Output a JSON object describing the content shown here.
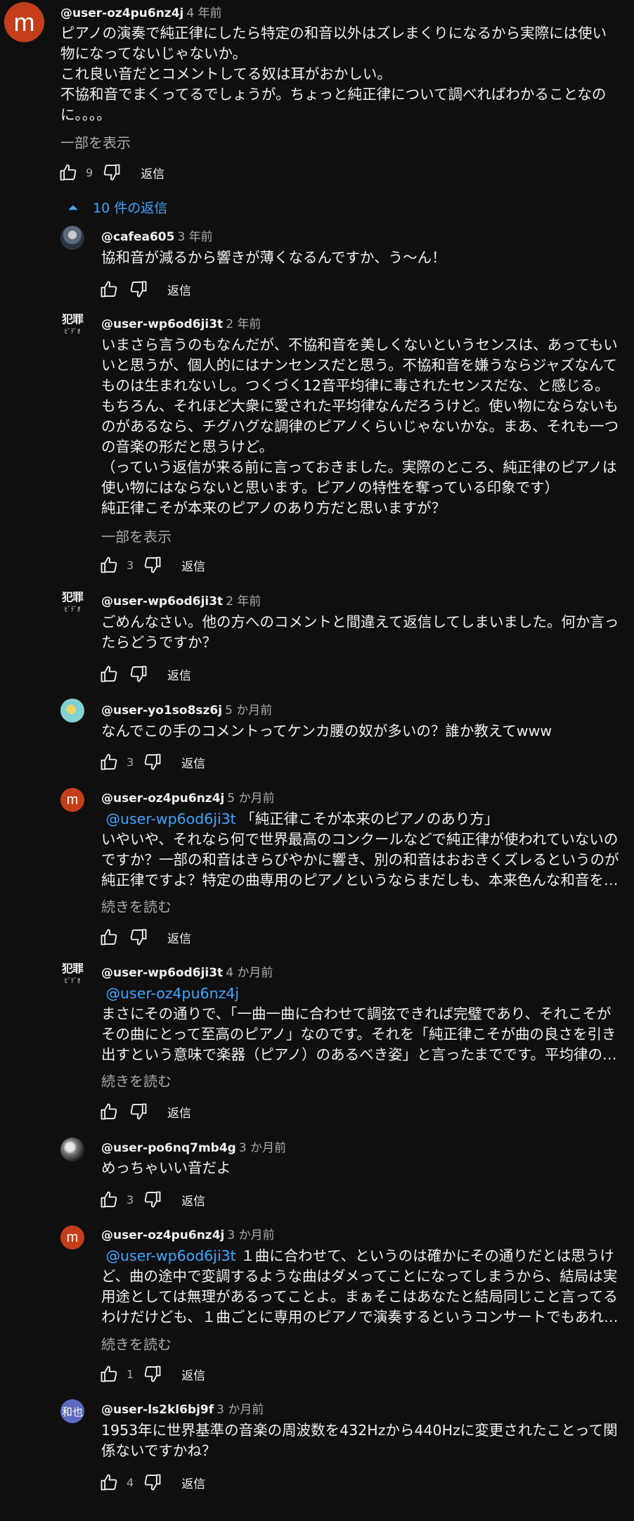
{
  "ui": {
    "show_more": "一部を表示",
    "read_more": "続きを読む",
    "reply": "返信"
  },
  "top_comment": {
    "avatar": "m",
    "author": "@user-oz4pu6nz4j",
    "time": "4 年前",
    "body_lines": [
      "ピアノの演奏で純正律にしたら特定の和音以外はズレまくりになるから実際には使い",
      "物になってないじゃないか。",
      "これ良い音だとコメントしてる奴は耳がおかしい。",
      "不協和音でまくってるでしょうが。ちょっと純正律について調べればわかることなの",
      "に。。。。"
    ],
    "likes": "9"
  },
  "replies_toggle": "10 件の返信",
  "replies": [
    {
      "author": "@cafea605",
      "time": "3 年前",
      "body_lines": [
        "協和音が減るから響きが薄くなるんですか、う〜ん！"
      ],
      "likes": ""
    },
    {
      "avatar_text": "犯罪",
      "avatar_sub": "ﾋﾞﾃﾞｵ",
      "author": "@user-wp6od6ji3t",
      "time": "2 年前",
      "body_lines": [
        "いまさら言うのもなんだが、不協和音を美しくないというセンスは、あってもい",
        "いと思うが、個人的にはナンセンスだと思う。不協和音を嫌うならジャズなんて",
        "ものは生まれないし。つくづく12音平均律に毒されたセンスだな、と感じる。",
        "もちろん、それほど大衆に愛された平均律なんだろうけど。使い物にならないも",
        "のがあるなら、チグハグな調律のピアノくらいじゃないかな。まあ、それも一つ",
        "の音楽の形だと思うけど。",
        "（っていう返信が来る前に言っておきました。実際のところ、純正律のピアノは",
        "使い物にはならないと思います。ピアノの特性を奪っている印象です）",
        "純正律こそが本来のピアノのあり方だと思いますが？"
      ],
      "likes": "3"
    },
    {
      "avatar_text": "犯罪",
      "avatar_sub": "ﾋﾞﾃﾞｵ",
      "author": "@user-wp6od6ji3t",
      "time": "2 年前",
      "body_lines": [
        "ごめんなさい。他の方へのコメントと間違えて返信してしまいました。何か言っ",
        "たらどうですか？"
      ],
      "likes": ""
    },
    {
      "author": "@user-yo1so8sz6j",
      "time": "5 か月前",
      "body_lines": [
        "なんでこの手のコメントってケンカ腰の奴が多いの？誰か教えてwww"
      ],
      "likes": "3"
    },
    {
      "avatar": "m",
      "author": "@user-oz4pu6nz4j",
      "time": "5 か月前",
      "mention": "@user-wp6od6ji3t",
      "mention_rest": "「純正律こそが本来のピアノのあり方」",
      "body_lines": [
        "いやいや、それなら何で世界最高のコンクールなどで純正律が使われていないの",
        "ですか？一部の和音はきらびやかに響き、別の和音はおおきくズレるというのが",
        "純正律ですよ？特定の曲専用のピアノというならまだしも、本来色んな和音を…"
      ],
      "likes": ""
    },
    {
      "avatar_text": "犯罪",
      "avatar_sub": "ﾋﾞﾃﾞｵ",
      "author": "@user-wp6od6ji3t",
      "time": "4 か月前",
      "mention": "@user-oz4pu6nz4j",
      "mention_rest": "",
      "body_lines": [
        "まさにその通りで、「一曲一曲に合わせて調弦できれば完璧であり、それこそが",
        "その曲にとって至高のピアノ」なのです。それを「純正律こそが曲の良さを引き",
        "出すという意味で楽器（ピアノ）のあるべき姿」と言ったまでです。平均律の…"
      ],
      "likes": ""
    },
    {
      "author": "@user-po6nq7mb4g",
      "time": "3 か月前",
      "body_lines": [
        "めっちゃいい音だよ"
      ],
      "likes": "3"
    },
    {
      "avatar": "m",
      "author": "@user-oz4pu6nz4j",
      "time": "3 か月前",
      "mention": "@user-wp6od6ji3t",
      "mention_rest": "１曲に合わせて、というのは確かにその通りだとは思うけ",
      "body_lines": [
        "ど、曲の途中で変調するような曲はダメってことになってしまうから、結局は実",
        "用途としては無理があるってことよ。まぁそこはあなたと結局同じこと言ってる",
        "わけだけども、１曲ごとに専用のピアノで演奏するというコンサートでもあれ…"
      ],
      "likes": "1"
    },
    {
      "avatar_text": "和也",
      "author": "@user-ls2kl6bj9f",
      "time": "3 か月前",
      "body_lines": [
        "1953年に世界基準の音楽の周波数を432Hzから440Hzに変更されたことって関",
        "係ないですかね？"
      ],
      "likes": "4"
    }
  ]
}
